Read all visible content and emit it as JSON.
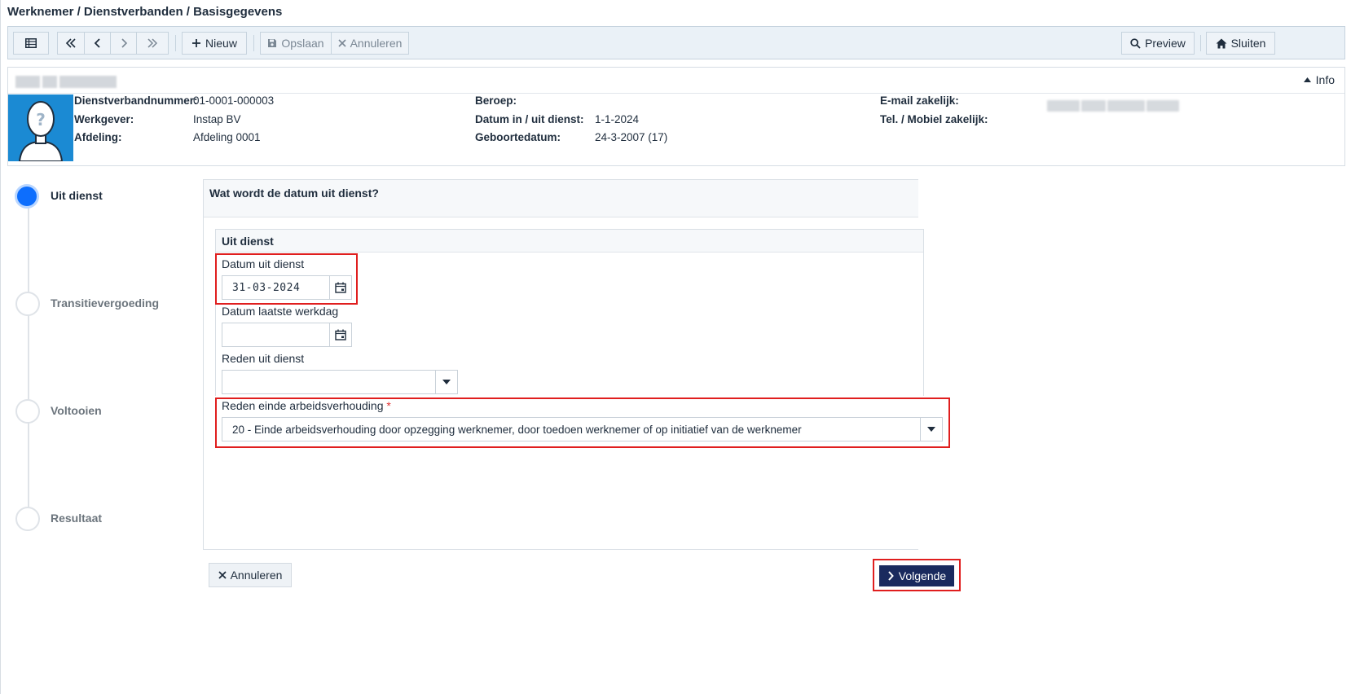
{
  "page": {
    "title": "Werknemer / Dienstverbanden / Basisgegevens"
  },
  "toolbar": {
    "new_label": "Nieuw",
    "save_label": "Opslaan",
    "cancel_label": "Annuleren",
    "preview_label": "Preview",
    "close_label": "Sluiten"
  },
  "card": {
    "info_label": "Info",
    "fields": {
      "dienstverband_label": "Dienstverbandnummer:",
      "dienstverband_value": "01-0001-000003",
      "werkgever_label": "Werkgever:",
      "werkgever_value": "Instap BV",
      "afdeling_label": "Afdeling:",
      "afdeling_value": "Afdeling 0001",
      "beroep_label": "Beroep:",
      "beroep_value": "",
      "datum_label": "Datum in / uit dienst:",
      "datum_value": "1-1-2024",
      "geboorte_label": "Geboortedatum:",
      "geboorte_value": "24-3-2007 (17)",
      "email_label": "E-mail zakelijk:",
      "tel_label": "Tel. / Mobiel zakelijk:"
    }
  },
  "stepper": {
    "steps": [
      {
        "label": "Uit dienst",
        "active": true
      },
      {
        "label": "Transitievergoeding",
        "active": false
      },
      {
        "label": "Voltooien",
        "active": false
      },
      {
        "label": "Resultaat",
        "active": false
      }
    ]
  },
  "form": {
    "question": "Wat wordt de datum uit dienst?",
    "section_title": "Uit dienst",
    "datum_uit_dienst_label": "Datum uit dienst",
    "datum_uit_dienst_value": "31-03-2024",
    "datum_laatste_werkdag_label": "Datum laatste werkdag",
    "datum_laatste_werkdag_value": "",
    "reden_uit_dienst_label": "Reden uit dienst",
    "reden_uit_dienst_value": "",
    "reden_einde_label": "Reden einde arbeidsverhouding",
    "required_mark": "*",
    "reden_einde_value": "20 - Einde arbeidsverhouding door opzegging werknemer, door toedoen werknemer of op initiatief van  de werknemer"
  },
  "footer": {
    "cancel_label": "Annuleren",
    "next_label": "Volgende"
  },
  "colors": {
    "accent": "#0d6efd",
    "primary_button": "#1a2a5e",
    "highlight": "#e01e1e",
    "avatar_bg": "#1b8ad3"
  }
}
